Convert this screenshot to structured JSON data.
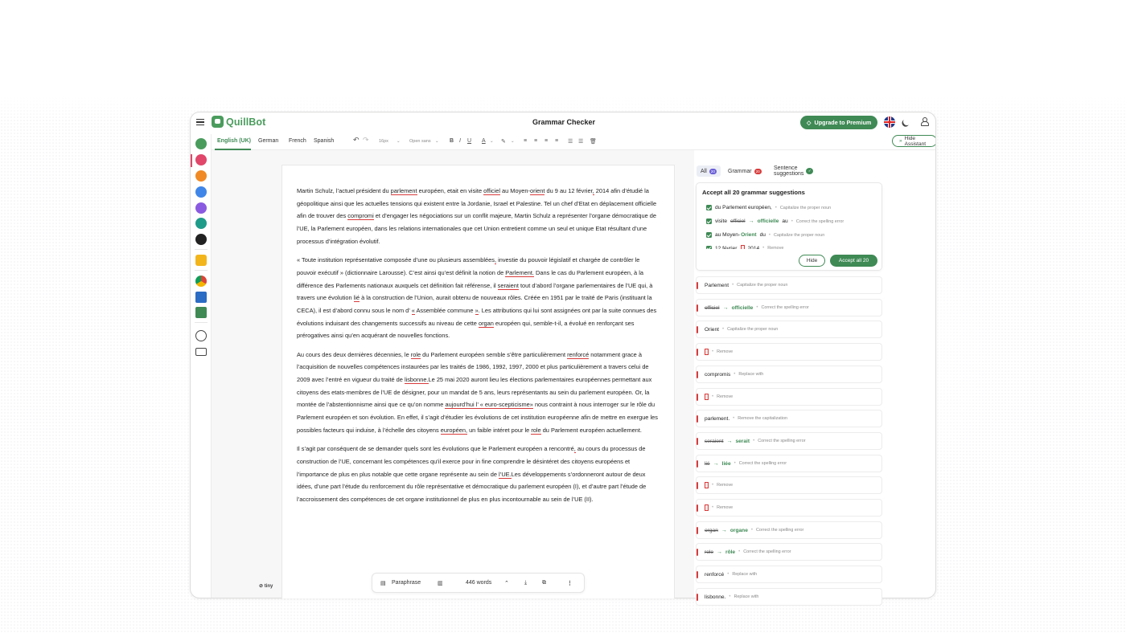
{
  "app": {
    "brand": "QuillBot",
    "title": "Grammar Checker",
    "premium_label": "Upgrade to Premium",
    "hide_assistant_label": "Hide Assistant"
  },
  "toolbar": {
    "languages": [
      "English (UK)",
      "German",
      "French",
      "Spanish"
    ],
    "active_language": "English (UK)",
    "font_size": "16px",
    "font_family": "Open sans"
  },
  "document": {
    "paragraphs": [
      [
        {
          "t": "Martin Schulz, l’actuel président du "
        },
        {
          "t": "parlement",
          "e": 1
        },
        {
          "t": " européen, etait en visite "
        },
        {
          "t": "officiel",
          "e": 1
        },
        {
          "t": " au Moyen-"
        },
        {
          "t": "orient",
          "e": 1
        },
        {
          "t": " du 9 au 12 février"
        },
        {
          "t": ",",
          "e": 1
        },
        {
          "t": " 2014 afin d’étudié la géopolitique ainsi que les actuelles tensions qui existent entre la Jordanie, Israel et Palestine. Tel un chef d’Etat en déplacement officielle afin de trouver des "
        },
        {
          "t": "compromi",
          "e": 1
        },
        {
          "t": " et d’engager les négociations sur un conflit majeure, Martin Schulz a représenter l’organe démocratique de l’UE, la Parlement européen, dans les relations internationales que cet Union entretient comme un seul et unique Etat résultant d’une processus d’intégration évolutif."
        }
      ],
      [
        {
          "t": "« Toute institution représentative composée d’une ou plusieurs assemblées"
        },
        {
          "t": ",",
          "e": 1
        },
        {
          "t": " investie du pouvoir législatif et chargée de contrôler le pouvoir exécutif » (dictionnaire Larousse). C’est ainsi qu’est définit la notion de "
        },
        {
          "t": "Parlement.",
          "e": 1
        },
        {
          "t": " Dans le cas du Parlement européen, à la différence des Parlements nationaux auxquels cet définition fait référense, il "
        },
        {
          "t": "seraient",
          "e": 1
        },
        {
          "t": " tout d’abord l’organe parlementaires de l’UE qui, à travers une évolution "
        },
        {
          "t": "lié",
          "e": 1
        },
        {
          "t": " à la construction de l’Union, aurait obtenu de nouveaux rôles. Créée en 1951 par le traité de Paris (instituant la CECA), il est d’abord connu sous le nom d’ "
        },
        {
          "t": "«",
          "e": 1
        },
        {
          "t": " Assemblée commune "
        },
        {
          "t": "»",
          "e": 1
        },
        {
          "t": ". Les attributions qui lui sont assignées ont par la suite connues des évolutions induisant des changements successifs au niveau de cette "
        },
        {
          "t": "organ",
          "e": 1
        },
        {
          "t": " européen qui, semble-t-il, a évolué en renforçant ses prérogatives ainsi qu’en acquérant de nouvelles fonctions."
        }
      ],
      [
        {
          "t": "Au cours des deux dernières décennies, le "
        },
        {
          "t": "role",
          "e": 1
        },
        {
          "t": " du Parlement européen semble s’être particulièrement "
        },
        {
          "t": "renforcé",
          "e": 1
        },
        {
          "t": " notamment grace à l’acquisition de nouvelles compétences instaurées par les traités de 1986, 1992, 1997, 2000 et plus particulièrement a travers celui de 2009 avec l’entré en vigueur du traité de "
        },
        {
          "t": "lisbonne.",
          "e": 1
        },
        {
          "t": "Le 25 mai 2020 auront lieu les élections parlementaires européennes permettant aux citoyens des etats-membres de l’UE de désigner, pour un mandat de 5 ans, leurs représentants au sein du parlement européen. Or, la montée de l’abstentionnisme ainsi que ce qu’on nomme "
        },
        {
          "t": "aujourd’hui l’ « euro-scepticisme»",
          "e": 1
        },
        {
          "t": " nous contraint à nous interroger sur le rôle du Parlement européen et son évolution. En effet, il s’agit d’étudier les évolutions de cet institution européenne afin de mettre en exergue les possibles facteurs qui induise, à l’échelle des citoyens "
        },
        {
          "t": "européen,",
          "e": 1
        },
        {
          "t": " un faible intéret pour le "
        },
        {
          "t": "role",
          "e": 1
        },
        {
          "t": " du Parlement européen actuellement."
        }
      ],
      [
        {
          "t": "Il s’agit par conséquent de se demander quels sont les évolutions que le Parlement européen a rencontré"
        },
        {
          "t": ",",
          "e": 1
        },
        {
          "t": " au cours du processus de construction de l’UE, concernant les compétences qu’il exerce pour in fine comprendre le désintéret des citoyens européens et l’importance de plus en plus notable que cette organe représente au sein de "
        },
        {
          "t": "l’UE.",
          "e": 1
        },
        {
          "t": "Les développements s’ordonneront autour de deux idées, d’une part l’étude du renforcement du rôle représentative et démocratique du parlement européen (I), et d’autre part l’étude de l’accroissement des compétences de cet organe institutionnel de plus en plus incontournable au sein de l’UE (II)."
        }
      ]
    ],
    "paraphrase_label": "Paraphrase",
    "word_count": "446 words",
    "tiny_label": "tiny"
  },
  "assistant": {
    "tabs": [
      {
        "label": "All",
        "count": "20",
        "badge_color": "#6b5fd6"
      },
      {
        "label": "Grammar",
        "count": "20",
        "badge_color": "#d83b3b"
      },
      {
        "label": "Sentence suggestions",
        "count": "",
        "badge_color": "#3f8a55"
      }
    ],
    "accept_title": "Accept all 20 grammar suggestions",
    "accept_rows": [
      {
        "before": "du Parlement européen,",
        "from": "",
        "to": "",
        "hint": "Capitalize the proper noun"
      },
      {
        "before": "visite",
        "from": "officiel",
        "to": "officielle",
        "after": "au",
        "hint": "Correct the spelling error"
      },
      {
        "before": "au Moyen-",
        "from": "",
        "to": "Orient",
        "after": "du",
        "hint": "Capitalize the proper noun"
      },
      {
        "before": "12 février",
        "from": "",
        "to": "",
        "after": "2014",
        "hint": "Remove"
      }
    ],
    "hide_label": "Hide",
    "accept_all_label": "Accept all 20",
    "suggestions": [
      {
        "from": "",
        "to": "Parlement",
        "hint": "Capitalize the proper noun",
        "kind": "plain"
      },
      {
        "from": "officiel",
        "to": "officielle",
        "hint": "Correct the spelling error",
        "kind": "replace"
      },
      {
        "from": "",
        "to": "Orient",
        "hint": "Capitalize the proper noun",
        "kind": "plain"
      },
      {
        "from": "",
        "to": "",
        "hint": "Remove",
        "kind": "remove"
      },
      {
        "from": "",
        "to": "compromis",
        "hint": "Replace with",
        "kind": "plain"
      },
      {
        "from": "",
        "to": "",
        "hint": "Remove",
        "kind": "remove"
      },
      {
        "from": "",
        "to": "parlement.",
        "hint": "Remove the capitalization",
        "kind": "plain"
      },
      {
        "from": "seraient",
        "to": "serait",
        "hint": "Correct the spelling error",
        "kind": "replace"
      },
      {
        "from": "lié",
        "to": "liée",
        "hint": "Correct the spelling error",
        "kind": "replace"
      },
      {
        "from": "",
        "to": "",
        "hint": "Remove",
        "kind": "remove"
      },
      {
        "from": "",
        "to": "",
        "hint": "Remove",
        "kind": "remove"
      },
      {
        "from": "organ",
        "to": "organe",
        "hint": "Correct the spelling error",
        "kind": "replace"
      },
      {
        "from": "role",
        "to": "rôle",
        "hint": "Correct the spelling error",
        "kind": "replace"
      },
      {
        "from": "",
        "to": "renforcé",
        "hint": "Replace with",
        "kind": "plain"
      },
      {
        "from": "",
        "to": "lisbonne.",
        "hint": "Replace with",
        "kind": "plain"
      }
    ]
  },
  "colors": {
    "brand_green": "#3f8a55",
    "error_red": "#d83b3b"
  }
}
